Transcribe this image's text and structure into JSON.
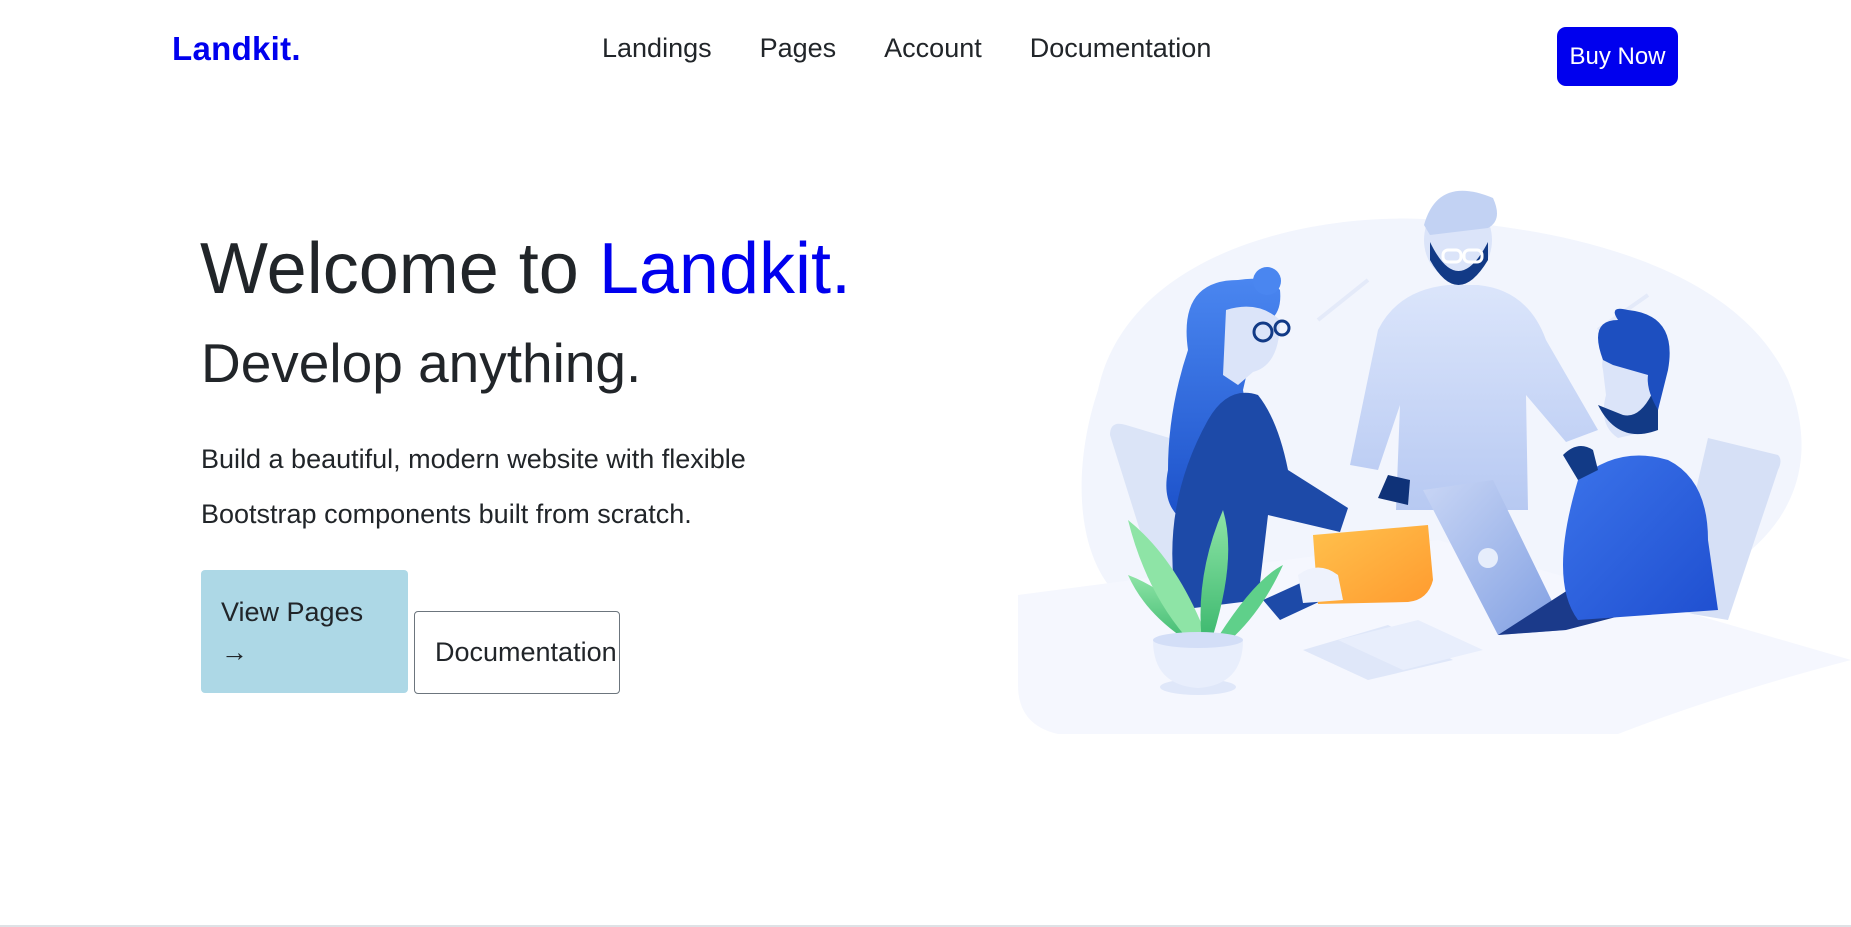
{
  "brand": {
    "logo": "Landkit."
  },
  "nav": {
    "items": [
      {
        "label": "Landings"
      },
      {
        "label": "Pages"
      },
      {
        "label": "Account"
      },
      {
        "label": "Documentation"
      }
    ],
    "cta_label": "Buy Now"
  },
  "hero": {
    "title_prefix": "Welcome to",
    "title_accent": "Landkit.",
    "subtitle": "Develop anything.",
    "lead": "Build a beautiful, modern website with flexible Bootstrap components built from scratch.",
    "primary_button": {
      "label": "View Pages",
      "icon": "arrow-right-icon",
      "glyph": "→"
    },
    "secondary_button": {
      "label": "Documentation"
    },
    "illustration": "team-meeting-illustration"
  },
  "colors": {
    "brand_blue": "#0000ee",
    "primary_button_bg": "#add8e6",
    "text": "#212529"
  }
}
